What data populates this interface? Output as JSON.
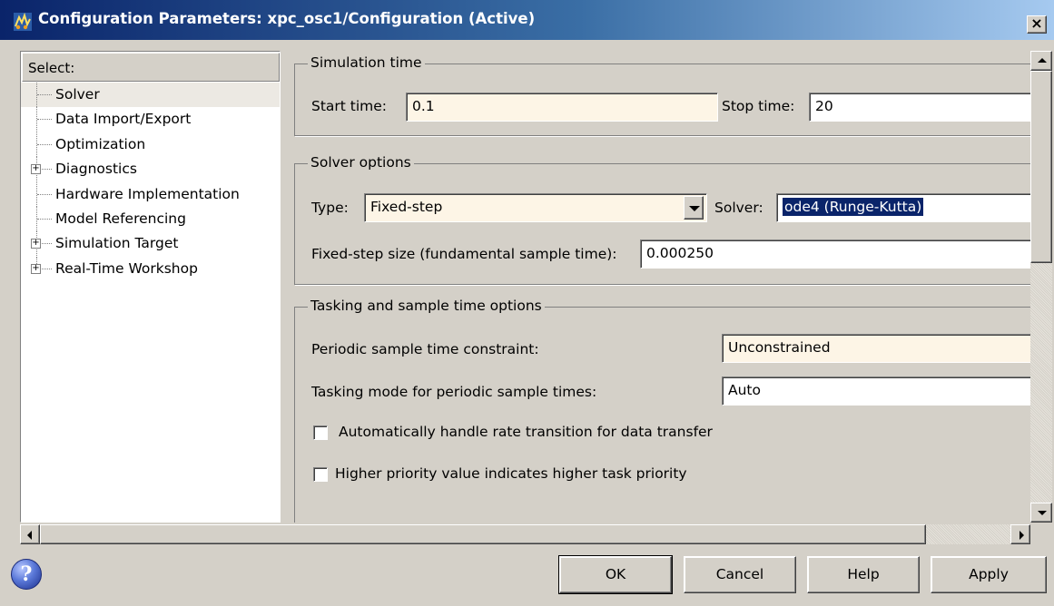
{
  "window": {
    "title": "Configuration Parameters: xpc_osc1/Configuration (Active)",
    "close_label": "×"
  },
  "tree": {
    "header": "Select:",
    "items": [
      {
        "label": "Solver",
        "expandable": false,
        "selected": true
      },
      {
        "label": "Data Import/Export",
        "expandable": false
      },
      {
        "label": "Optimization",
        "expandable": false
      },
      {
        "label": "Diagnostics",
        "expandable": true
      },
      {
        "label": "Hardware Implementation",
        "expandable": false
      },
      {
        "label": "Model Referencing",
        "expandable": false
      },
      {
        "label": "Simulation Target",
        "expandable": true
      },
      {
        "label": "Real-Time Workshop",
        "expandable": true
      }
    ],
    "expander_symbol": "+"
  },
  "simulation_time": {
    "legend": "Simulation time",
    "start_label": "Start time:",
    "start_value": "0.1",
    "stop_label": "Stop time:",
    "stop_value": "20"
  },
  "solver_options": {
    "legend": "Solver options",
    "type_label": "Type:",
    "type_value": "Fixed-step",
    "solver_label": "Solver:",
    "solver_value": "ode4 (Runge-Kutta)",
    "step_label": "Fixed-step size (fundamental sample time):",
    "step_value": "0.000250"
  },
  "tasking": {
    "legend": "Tasking and sample time options",
    "periodic_label": "Periodic sample time constraint:",
    "periodic_value": "Unconstrained",
    "mode_label": "Tasking mode for periodic sample times:",
    "mode_value": "Auto",
    "rate_transition_label": "Automatically handle rate transition for data transfer",
    "rate_transition_checked": false,
    "priority_label": "Higher priority value indicates higher task priority",
    "priority_checked": false
  },
  "buttons": {
    "help_icon": "?",
    "ok": "OK",
    "cancel": "Cancel",
    "help": "Help",
    "apply": "Apply"
  },
  "colors": {
    "titlebar_start": "#0a246a",
    "titlebar_end": "#a6caf0",
    "dialog_bg": "#d4d0c8",
    "tinted_field": "#fdf5e6",
    "selection": "#0a246a"
  }
}
